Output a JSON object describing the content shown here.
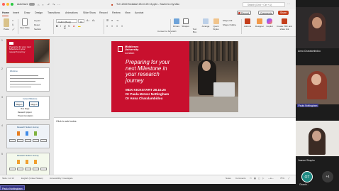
{
  "window": {
    "autosave_label": "AutoSave",
    "toggle_state": "Off",
    "doc_title": "TU 12040 Kickstart 28.10.25 v3.pptx - Saved to my Mac",
    "search_placeholder": "Search (Cmd + Ctrl + U)"
  },
  "ribbon_tabs": [
    "Home",
    "Insert",
    "Draw",
    "Design",
    "Transitions",
    "Animations",
    "Slide Show",
    "Record",
    "Review",
    "View",
    "Acrobat"
  ],
  "ribbon_buttons": {
    "record": "Record",
    "comments": "Comments",
    "share": "Share"
  },
  "ribbon": {
    "paste": "Paste",
    "new_slide": "New Slide",
    "reuse_slides": "Reuse Slides",
    "layout": "Layout",
    "reset": "Reset",
    "section": "Section",
    "font_name": "Calibri (Body)",
    "font_size": "18",
    "convert_smartart": "Convert to SmartArt",
    "picture": "Picture",
    "shapes": "Shapes",
    "text_box": "Text Box",
    "arrange": "Arrange",
    "quick_styles": "Quick Styles",
    "shape_fill": "Shape Fill",
    "shape_outline": "Shape Outline",
    "add_ins": "Add-ins",
    "designer": "Designer",
    "copilot": "Copilot",
    "create_pdf": "Create PDF and share link"
  },
  "thumbnails": [
    {
      "num": "1",
      "text": "Preparing for your next Milestone in your research journey"
    },
    {
      "num": "2",
      "heading": "Welcome"
    },
    {
      "num": "3",
      "heading": "Current Milestone",
      "stage1": "Stage 1",
      "stage2": "Stage 2",
      "line1": "Viva Stage",
      "line2": "Research project",
      "line3": "Thesis Completion"
    },
    {
      "num": "4",
      "heading": "Research Student Journey"
    },
    {
      "num": "5",
      "heading": "Research Student Journey"
    }
  ],
  "slide": {
    "logo_line1": "Middlesex",
    "logo_line2": "University",
    "logo_line3": "London",
    "title_line1": "Preparing for your",
    "title_line2": "next Milestone in",
    "title_line3": "your research",
    "title_line4": "journey",
    "sub_line1": "MDX KICKSTART 28.10.25",
    "sub_line2": "Dr Paula McIver Nottingham",
    "sub_line3": "Dr Anna Charalambidou"
  },
  "notes_placeholder": "Click to add notes",
  "status": {
    "slide": "Slide 1 of 13",
    "language": "English (United States)",
    "accessibility": "Accessibility: Investigate",
    "notes": "Notes",
    "comments": "Comments",
    "zoom": "75%"
  },
  "participants": [
    {
      "name": "Anna Charalambidou",
      "speaking": false
    },
    {
      "name": "Paula Nottingham",
      "speaking": true
    },
    {
      "name": "Joanne Shapiro",
      "speaking": false
    },
    {
      "name": "Olusolo...",
      "speaking": false
    }
  ],
  "bottom_name_tag": "Paula Nottingham",
  "avatar_initials": "OT",
  "more_count": "+4",
  "colors": {
    "accent": "#c43e1c",
    "slide_red": "#c8102e",
    "speaking_tag": "#3a3a8a"
  }
}
